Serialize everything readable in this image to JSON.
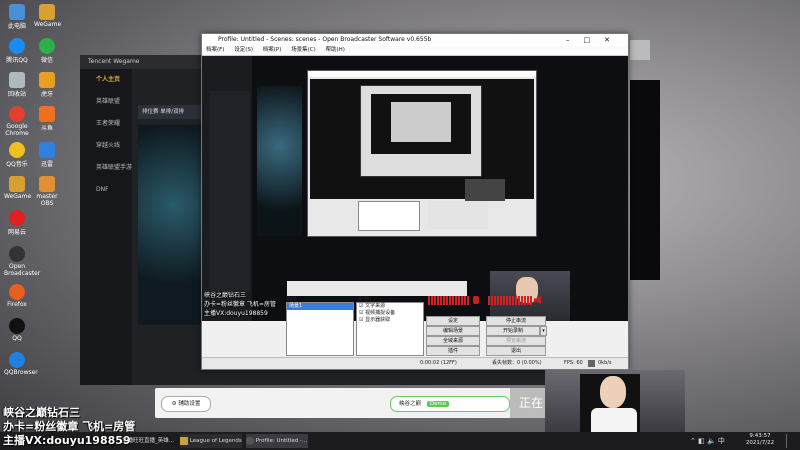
{
  "desktop_icons": [
    {
      "label": "此电脑",
      "color": "#4a8fd8"
    },
    {
      "label": "WeGame",
      "color": "#d8a030"
    },
    {
      "label": "腾讯QQ",
      "color": "#1a8cf0"
    },
    {
      "label": "微信",
      "color": "#2cb04a"
    },
    {
      "label": "回收站",
      "color": "#b0b8c0"
    },
    {
      "label": "虎牙",
      "color": "#e8a020"
    },
    {
      "label": "Google Chrome",
      "color": "#e04030"
    },
    {
      "label": "斗鱼",
      "color": "#f07020"
    },
    {
      "label": "QQ音乐",
      "color": "#f0c020"
    },
    {
      "label": "迅雷",
      "color": "#3080e0"
    },
    {
      "label": "WeGame",
      "color": "#d8a030"
    },
    {
      "label": "master OBS",
      "color": "#e09030"
    },
    {
      "label": "网易云",
      "color": "#e02020"
    },
    {
      "label": "Open Broadcaster",
      "color": "#333"
    },
    {
      "label": "Firefox",
      "color": "#e86020"
    },
    {
      "label": "QQ",
      "color": "#111"
    },
    {
      "label": "QQBrowser",
      "color": "#2080e0"
    }
  ],
  "tencent": {
    "title": "Tencent Wegame",
    "user": "个人主页",
    "nav": [
      "英雄联盟",
      "王者荣耀",
      "穿越火线",
      "英雄联盟手游",
      "DNF",
      "小三角"
    ],
    "banner": "排位赛 单排/双排"
  },
  "obs": {
    "title": "Profile: Untitled - Scenes: scenes - Open Broadcaster Software v0.655b",
    "menu": [
      "档案(F)",
      "设定(S)",
      "档案(P)",
      "场景集(C)",
      "帮助(H)"
    ],
    "scenes_label": "场景：",
    "scene_item": "场景1",
    "sources_label": "来源：",
    "sources": [
      "文字来源",
      "视频捕捉设备",
      "显示器获取"
    ],
    "buttons": {
      "settings": "设定",
      "start_stream": "停止串流",
      "edit_scene": "编辑场景",
      "start_recording": "开始录制",
      "global_sources": "全域来源",
      "plugins": "预览串流",
      "plugins2": "插件",
      "exit": "退出"
    },
    "status": {
      "time": "0:00:02 (12FF)",
      "dropped": "丢失帧数：0 (0.00%)",
      "fps": "FPS: 60",
      "kbps": "0kb/s"
    }
  },
  "stream_overlay": {
    "line1": "峡谷之巅钻石三",
    "line2": "办卡=粉丝徽章 飞机=房管",
    "line3": "主播VX:douyu198859"
  },
  "bottom_bar": {
    "help_btn": "辅助设置",
    "queue_btn": "峡谷之巅",
    "badge": "Demo",
    "right_btn": "正在"
  },
  "taskbar": {
    "items": [
      "主播旺旺直播_英雄...",
      "League of Legends",
      "Profile: Untitled -..."
    ],
    "time": "9:43:57",
    "date": "2021/7/22"
  }
}
